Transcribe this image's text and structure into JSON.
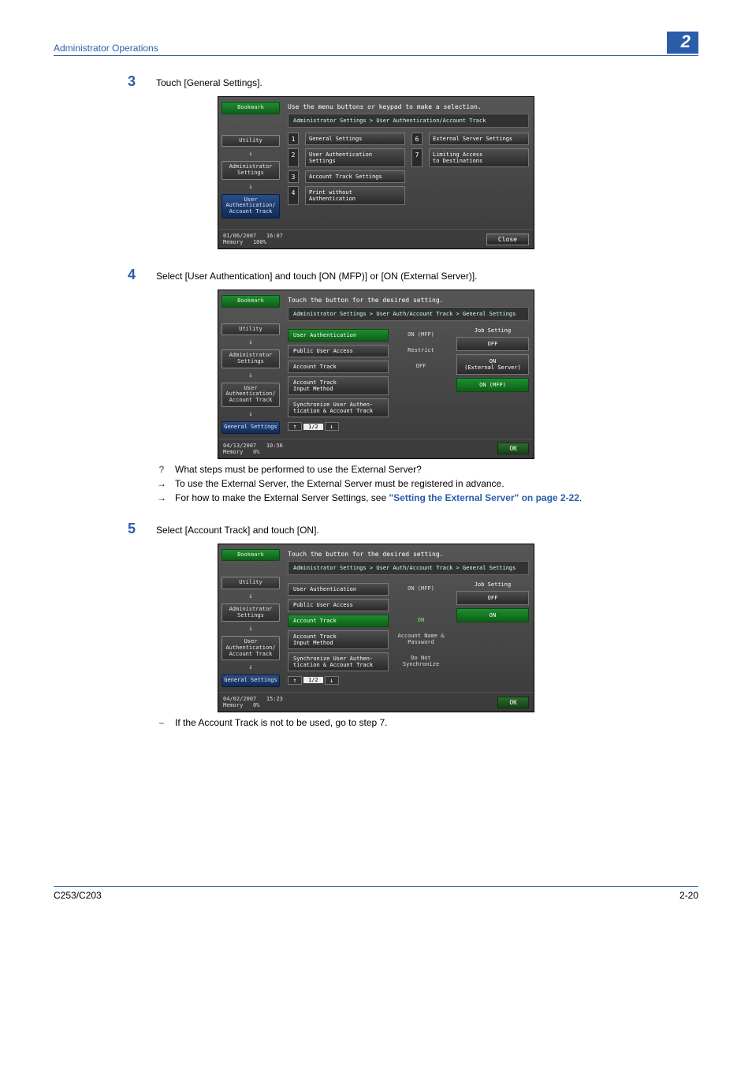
{
  "header": {
    "title": "Administrator Operations",
    "chapter": "2"
  },
  "steps": {
    "s3": {
      "num": "3",
      "text": "Touch [General Settings]."
    },
    "s4": {
      "num": "4",
      "text": "Select [User Authentication] and touch [ON (MFP)] or [ON (External Server)]."
    },
    "s5": {
      "num": "5",
      "text": "Select [Account Track] and touch [ON]."
    }
  },
  "notes": {
    "q": "What steps must be performed to use the External Server?",
    "a1": "To use the External Server, the External Server must be registered in advance.",
    "a2_pre": "For how to make the External Server Settings, see ",
    "a2_link": "\"Setting the External Server\" on page 2-22",
    "a2_post": ".",
    "s5_sub": "If the Account Track is not to be used, go to step 7."
  },
  "footer": {
    "left": "C253/C203",
    "right": "2-20"
  },
  "screen1": {
    "prompt": "Use the menu buttons or keypad to make a selection.",
    "breadcrumb": "Administrator Settings > User Authentication/Account Track",
    "sidebar": {
      "bookmark": "Bookmark",
      "utility": "Utility",
      "admin": "Administrator\nSettings",
      "uaa": "User\nAuthentication/\nAccount Track"
    },
    "items": {
      "n1": "1",
      "l1": "General Settings",
      "n2": "2",
      "l2": "User Authentication\nSettings",
      "n3": "3",
      "l3": "Account Track Settings",
      "n4": "4",
      "l4": "Print without\nAuthentication",
      "n6": "6",
      "l6": "External Server Settings",
      "n7": "7",
      "l7": "Limiting Access\nto Destinations"
    },
    "status": {
      "date": "01/06/2007",
      "time": "16:07",
      "mem_label": "Memory",
      "mem_val": "100%",
      "close": "Close"
    }
  },
  "screen2": {
    "prompt": "Touch the button for the desired setting.",
    "breadcrumb": "Administrator Settings > User Auth/Account Track  > General Settings",
    "sidebar": {
      "bookmark": "Bookmark",
      "utility": "Utility",
      "admin": "Administrator\nSettings",
      "uaa": "User\nAuthentication/\nAccount Track",
      "gs": "General Settings"
    },
    "rows": {
      "r1l": "User Authentication",
      "r1v": "ON (MFP)",
      "r2l": "Public User Access",
      "r2v": "Restrict",
      "r3l": "Account Track",
      "r3v": "OFF",
      "r4l": "Account Track\nInput Method",
      "r5l": "Synchronize User Authen-\ntication & Account Track"
    },
    "right": {
      "title": "Job Setting",
      "b1": "OFF",
      "b2": "ON\n(External Server)",
      "b3": "ON (MFP)"
    },
    "pager": {
      "ind": "1/2"
    },
    "status": {
      "date": "04/13/2007",
      "time": "10:56",
      "mem_label": "Memory",
      "mem_val": "0%",
      "ok": "OK"
    }
  },
  "screen3": {
    "prompt": "Touch the button for the desired setting.",
    "breadcrumb": "Administrator Settings > User Auth/Account Track  > General Settings",
    "sidebar": {
      "bookmark": "Bookmark",
      "utility": "Utility",
      "admin": "Administrator\nSettings",
      "uaa": "User\nAuthentication/\nAccount Track",
      "gs": "General Settings"
    },
    "rows": {
      "r1l": "User Authentication",
      "r1v": "ON (MFP)",
      "r2l": "Public User Access",
      "r2v": "",
      "r3l": "Account Track",
      "r3v": "ON",
      "r4l": "Account Track\nInput Method",
      "r4v": "Account Name &\nPassword",
      "r5l": "Synchronize User Authen-\ntication & Account Track",
      "r5v": "Do Not\nSynchronize"
    },
    "right": {
      "title": "Job Setting",
      "b1": "OFF",
      "b2": "ON"
    },
    "pager": {
      "ind": "1/2"
    },
    "status": {
      "date": "04/02/2007",
      "time": "15:23",
      "mem_label": "Memory",
      "mem_val": "0%",
      "ok": "OK"
    }
  }
}
